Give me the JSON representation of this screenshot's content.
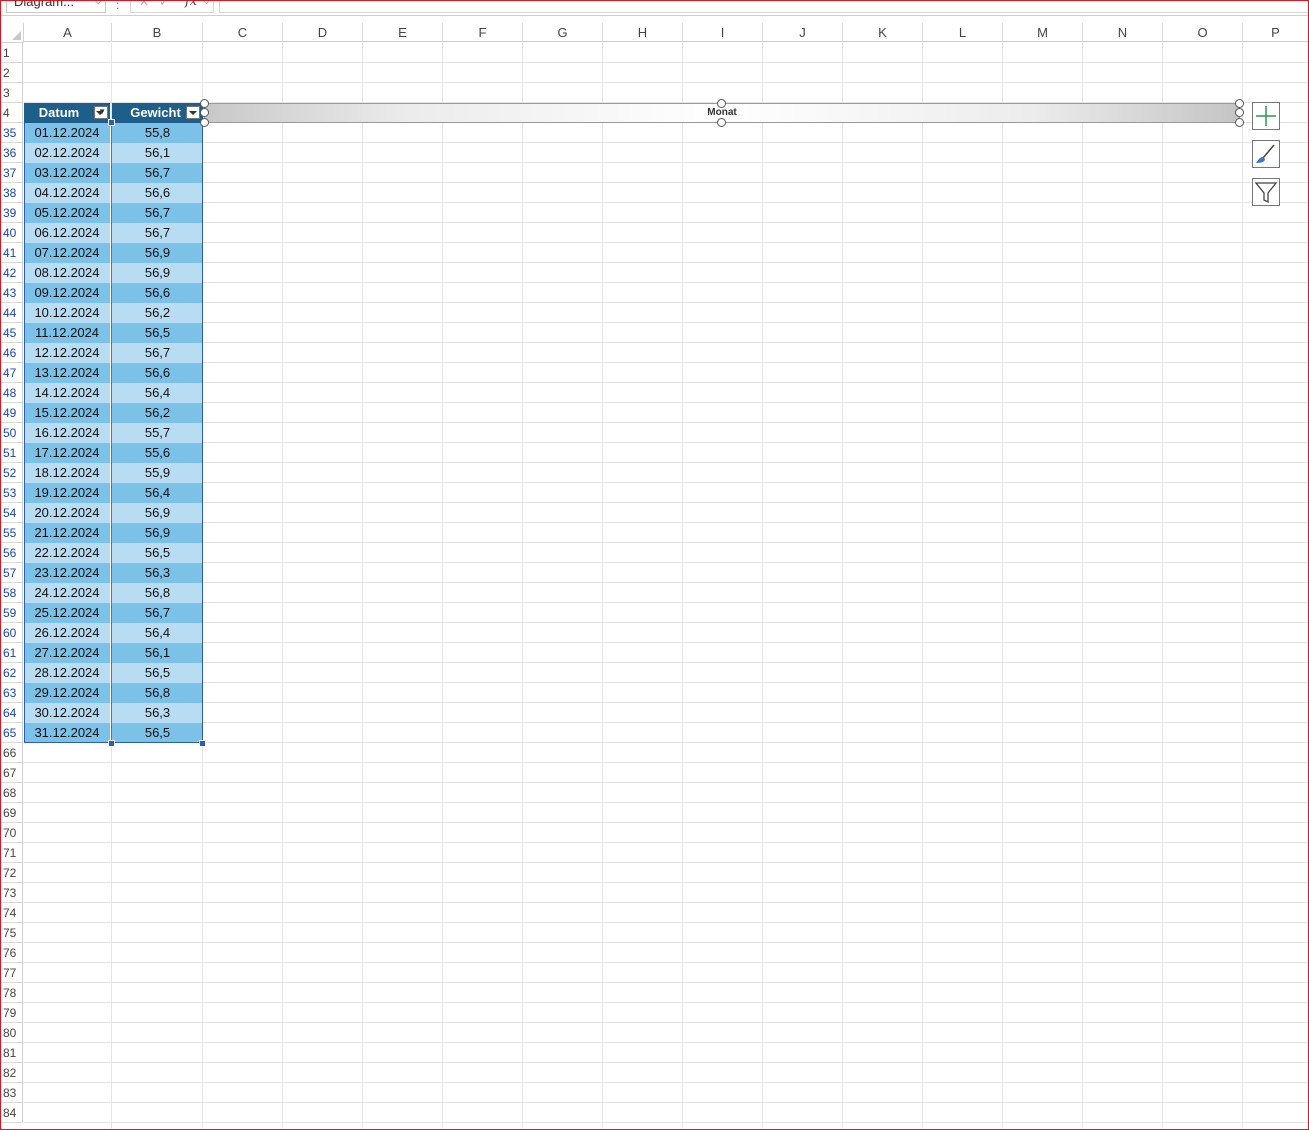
{
  "formula_bar": {
    "name_box": "Diagram...",
    "separator": ":",
    "cancel_glyph": "✕",
    "confirm_glyph": "✓",
    "fx_label": "fx",
    "formula": ""
  },
  "columns": [
    "A",
    "B",
    "C",
    "D",
    "E",
    "F",
    "G",
    "H",
    "I",
    "J",
    "K",
    "L",
    "M",
    "N",
    "O",
    "P"
  ],
  "rows": [
    "1",
    "2",
    "3",
    "4",
    "35",
    "36",
    "37",
    "38",
    "39",
    "40",
    "41",
    "42",
    "43",
    "44",
    "45",
    "46",
    "47",
    "48",
    "49",
    "50",
    "51",
    "52",
    "53",
    "54",
    "55",
    "56",
    "57",
    "58",
    "59",
    "60",
    "61",
    "62",
    "63",
    "64",
    "65",
    "66",
    "67",
    "68",
    "69",
    "70",
    "71",
    "72",
    "73",
    "74",
    "75",
    "76",
    "77",
    "78",
    "79",
    "80",
    "81",
    "82",
    "83",
    "84"
  ],
  "table": {
    "headers": [
      "Datum",
      "Gewicht"
    ],
    "rows": [
      [
        "01.12.2024",
        "55,8"
      ],
      [
        "02.12.2024",
        "56,1"
      ],
      [
        "03.12.2024",
        "56,7"
      ],
      [
        "04.12.2024",
        "56,6"
      ],
      [
        "05.12.2024",
        "56,7"
      ],
      [
        "06.12.2024",
        "56,7"
      ],
      [
        "07.12.2024",
        "56,9"
      ],
      [
        "08.12.2024",
        "56,9"
      ],
      [
        "09.12.2024",
        "56,6"
      ],
      [
        "10.12.2024",
        "56,2"
      ],
      [
        "11.12.2024",
        "56,5"
      ],
      [
        "12.12.2024",
        "56,7"
      ],
      [
        "13.12.2024",
        "56,6"
      ],
      [
        "14.12.2024",
        "56,4"
      ],
      [
        "15.12.2024",
        "56,2"
      ],
      [
        "16.12.2024",
        "55,7"
      ],
      [
        "17.12.2024",
        "55,6"
      ],
      [
        "18.12.2024",
        "55,9"
      ],
      [
        "19.12.2024",
        "56,4"
      ],
      [
        "20.12.2024",
        "56,9"
      ],
      [
        "21.12.2024",
        "56,9"
      ],
      [
        "22.12.2024",
        "56,5"
      ],
      [
        "23.12.2024",
        "56,3"
      ],
      [
        "24.12.2024",
        "56,8"
      ],
      [
        "25.12.2024",
        "56,7"
      ],
      [
        "26.12.2024",
        "56,4"
      ],
      [
        "27.12.2024",
        "56,1"
      ],
      [
        "28.12.2024",
        "56,5"
      ],
      [
        "29.12.2024",
        "56,8"
      ],
      [
        "30.12.2024",
        "56,3"
      ],
      [
        "31.12.2024",
        "56,5"
      ]
    ]
  },
  "chart": {
    "axis_label": "Monat"
  },
  "chart_buttons": [
    "chart-elements",
    "chart-styles",
    "chart-filters"
  ],
  "colors": {
    "table_header": "#1d5f8a",
    "band_dark": "#7cc1e8",
    "band_light": "#b8dcf2",
    "selection": "#2b5fb0",
    "window_border": "#e0141e"
  }
}
